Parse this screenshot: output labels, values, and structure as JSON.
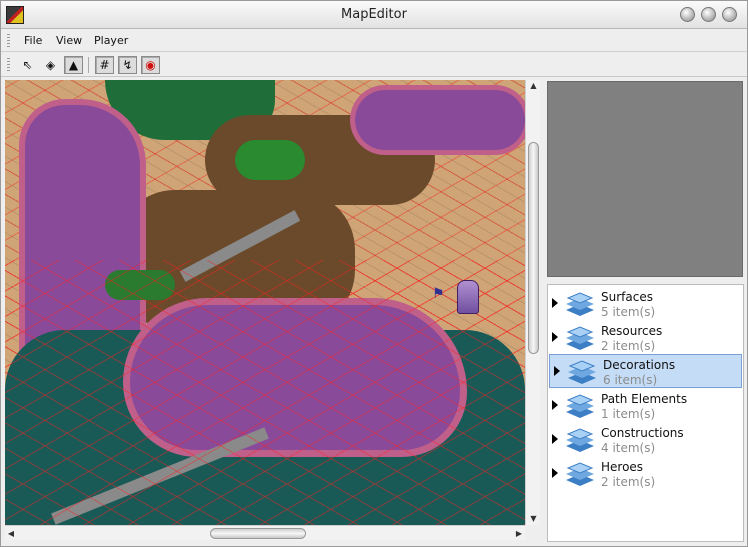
{
  "window": {
    "title": "MapEditor"
  },
  "menubar": {
    "items": [
      "File",
      "View",
      "Player"
    ]
  },
  "toolbar": {
    "tools": [
      {
        "name": "select-arrow-icon",
        "glyph": "⇖",
        "pressed": false
      },
      {
        "name": "eraser-icon",
        "glyph": "◈",
        "pressed": false
      },
      {
        "name": "pointer-up-icon",
        "glyph": "▲",
        "pressed": true
      },
      {
        "name": "grid-icon",
        "glyph": "#",
        "pressed": true
      },
      {
        "name": "path-icon",
        "glyph": "↯",
        "pressed": true
      },
      {
        "name": "passability-eye-icon",
        "glyph": "◉",
        "pressed": true
      }
    ]
  },
  "tree": {
    "categories": [
      {
        "name": "Surfaces",
        "count": "5 item(s)",
        "selected": false
      },
      {
        "name": "Resources",
        "count": "2 item(s)",
        "selected": false
      },
      {
        "name": "Decorations",
        "count": "6 item(s)",
        "selected": true
      },
      {
        "name": "Path Elements",
        "count": "1 item(s)",
        "selected": false
      },
      {
        "name": "Constructions",
        "count": "4 item(s)",
        "selected": false
      },
      {
        "name": "Heroes",
        "count": "2 item(s)",
        "selected": false
      }
    ]
  },
  "colors": {
    "sand": "#cfa577",
    "water": "#8a4a9a",
    "forest": "#1f6e3a",
    "dirt": "#6a4a2a",
    "overlay_red": "#ff2020",
    "selection": "#c5dcf7"
  }
}
